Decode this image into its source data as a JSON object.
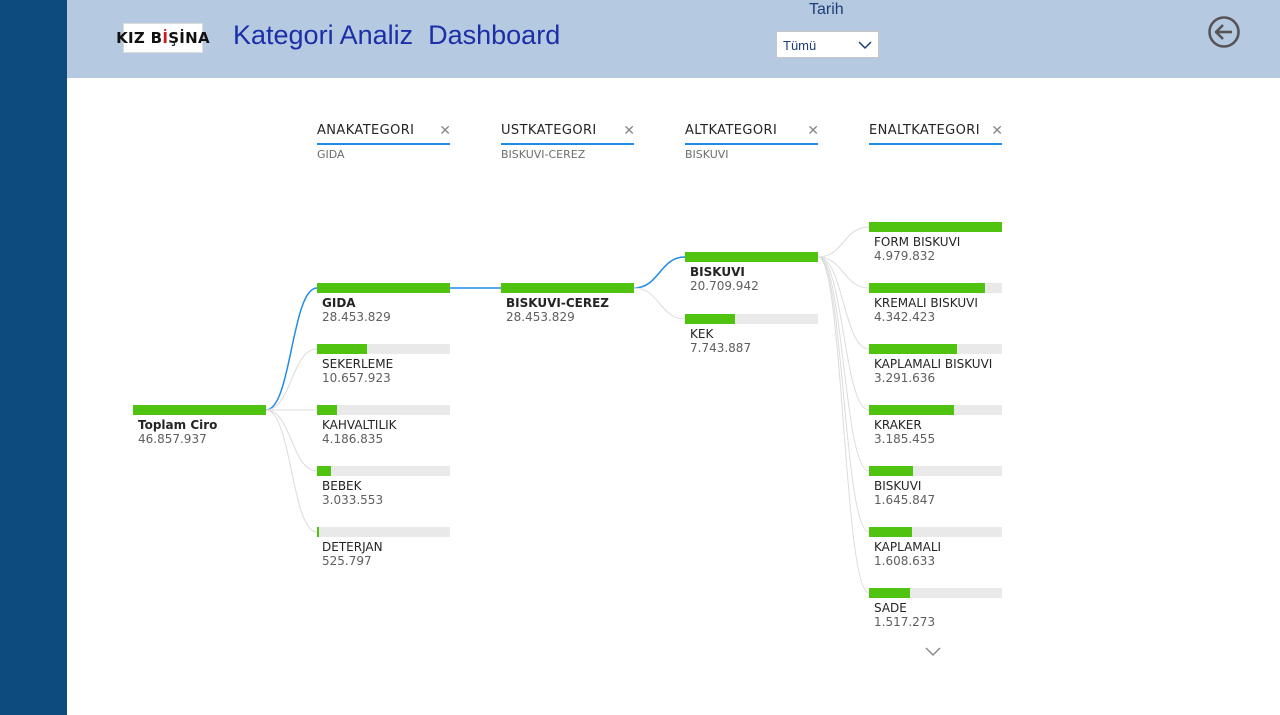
{
  "header": {
    "logo_text": "KIZ BİŞİNA",
    "title": "Kategori Analiz  Dashboard",
    "date_filter": {
      "label": "Tarih",
      "value": "Tümü"
    }
  },
  "colors": {
    "sidebar": "#0d4a7e",
    "header": "#b5c9e0",
    "bar": "#4fc30f",
    "track": "#e9e9e9",
    "link": "#1f8be6"
  },
  "tree": {
    "columns": [
      {
        "header": "ANAKATEGORI",
        "filter": "GIDA"
      },
      {
        "header": "USTKATEGORI",
        "filter": "BISKUVI-CEREZ"
      },
      {
        "header": "ALTKATEGORI",
        "filter": "BISKUVI"
      },
      {
        "header": "ENALTKATEGORI",
        "filter": ""
      }
    ],
    "root": {
      "label": "Toplam Ciro",
      "value": "46.857.937",
      "amount": 46857937
    },
    "anakategori": [
      {
        "label": "GIDA",
        "value": "28.453.829",
        "amount": 28453829,
        "selected": true
      },
      {
        "label": "SEKERLEME",
        "value": "10.657.923",
        "amount": 10657923
      },
      {
        "label": "KAHVALTILIK",
        "value": "4.186.835",
        "amount": 4186835
      },
      {
        "label": "BEBEK",
        "value": "3.033.553",
        "amount": 3033553
      },
      {
        "label": "DETERJAN",
        "value": "525.797",
        "amount": 525797
      }
    ],
    "ustkategori": [
      {
        "label": "BISKUVI-CEREZ",
        "value": "28.453.829",
        "amount": 28453829,
        "selected": true
      }
    ],
    "altkategori": [
      {
        "label": "BISKUVI",
        "value": "20.709.942",
        "amount": 20709942,
        "selected": true
      },
      {
        "label": "KEK",
        "value": "7.743.887",
        "amount": 7743887
      }
    ],
    "enaltkategori": [
      {
        "label": "FORM BISKUVI",
        "value": "4.979.832",
        "amount": 4979832
      },
      {
        "label": "KREMALI BISKUVI",
        "value": "4.342.423",
        "amount": 4342423
      },
      {
        "label": "KAPLAMALI BISKUVI",
        "value": "3.291.636",
        "amount": 3291636
      },
      {
        "label": "KRAKER",
        "value": "3.185.455",
        "amount": 3185455
      },
      {
        "label": "BISKUVI",
        "value": "1.645.847",
        "amount": 1645847
      },
      {
        "label": "KAPLAMALI",
        "value": "1.608.633",
        "amount": 1608633
      },
      {
        "label": "SADE",
        "value": "1.517.273",
        "amount": 1517273
      }
    ]
  }
}
